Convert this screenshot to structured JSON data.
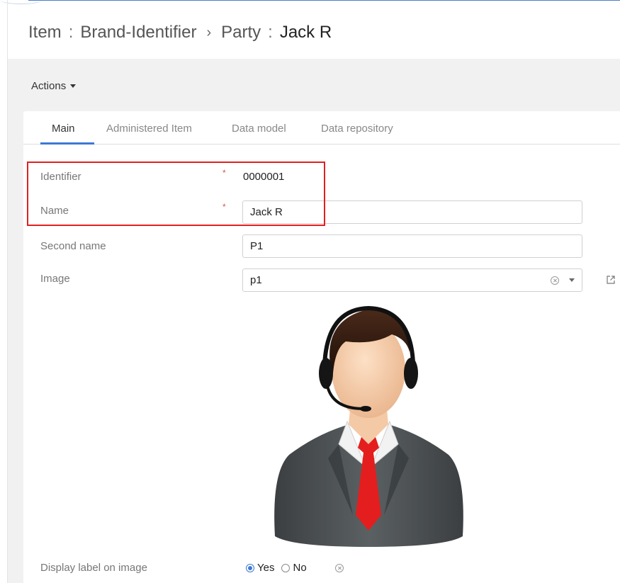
{
  "breadcrumb": {
    "item_label": "Item",
    "sep1": ":",
    "dataset": "Brand-Identifier",
    "arrow": "›",
    "party_label": "Party",
    "sep2": ":",
    "current": "Jack R"
  },
  "toolbar": {
    "actions_label": "Actions"
  },
  "tabs": [
    {
      "label": "Main",
      "active": true
    },
    {
      "label": "Administered Item",
      "active": false
    },
    {
      "label": "Data model",
      "active": false
    },
    {
      "label": "Data repository",
      "active": false
    }
  ],
  "form": {
    "identifier": {
      "label": "Identifier",
      "required": "*",
      "value": "0000001"
    },
    "name": {
      "label": "Name",
      "required": "*",
      "value": "Jack R"
    },
    "second_name": {
      "label": "Second name",
      "value": "P1"
    },
    "image": {
      "label": "Image",
      "value": "p1"
    },
    "display_label": {
      "label": "Display label on image",
      "options": [
        "Yes",
        "No"
      ],
      "selected": "Yes"
    }
  },
  "colors": {
    "accent": "#3d78d6",
    "highlight": "#e02020",
    "required": "#d9534f",
    "tie": "#e41e1e",
    "suit": "#4a4f52"
  },
  "icons": {
    "actions_caret": "caret-down-icon",
    "image_clear": "clear-circle-icon",
    "image_dropdown": "chevron-down-icon",
    "image_open": "external-link-icon",
    "radio_clear": "clear-circle-icon"
  }
}
